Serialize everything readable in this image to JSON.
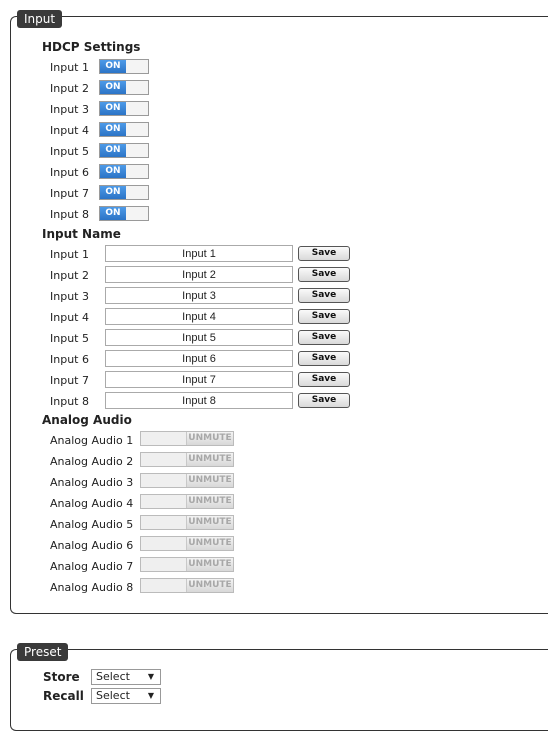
{
  "input_panel": {
    "legend": "Input"
  },
  "hdcp": {
    "title": "HDCP Settings",
    "on_label": "ON",
    "rows": [
      {
        "label": "Input 1"
      },
      {
        "label": "Input 2"
      },
      {
        "label": "Input 3"
      },
      {
        "label": "Input 4"
      },
      {
        "label": "Input 5"
      },
      {
        "label": "Input 6"
      },
      {
        "label": "Input 7"
      },
      {
        "label": "Input 8"
      }
    ]
  },
  "input_name": {
    "title": "Input Name",
    "save_label": "Save",
    "rows": [
      {
        "label": "Input 1",
        "value": "Input 1"
      },
      {
        "label": "Input 2",
        "value": "Input 2"
      },
      {
        "label": "Input 3",
        "value": "Input 3"
      },
      {
        "label": "Input 4",
        "value": "Input 4"
      },
      {
        "label": "Input 5",
        "value": "Input 5"
      },
      {
        "label": "Input 6",
        "value": "Input 6"
      },
      {
        "label": "Input 7",
        "value": "Input 7"
      },
      {
        "label": "Input 8",
        "value": "Input 8"
      }
    ]
  },
  "analog_audio": {
    "title": "Analog Audio",
    "unmute_label": "UNMUTE",
    "rows": [
      {
        "label": "Analog Audio 1"
      },
      {
        "label": "Analog Audio 2"
      },
      {
        "label": "Analog Audio 3"
      },
      {
        "label": "Analog Audio 4"
      },
      {
        "label": "Analog Audio 5"
      },
      {
        "label": "Analog Audio 6"
      },
      {
        "label": "Analog Audio 7"
      },
      {
        "label": "Analog Audio 8"
      }
    ]
  },
  "preset_panel": {
    "legend": "Preset",
    "store_label": "Store",
    "recall_label": "Recall",
    "store_value": "Select",
    "recall_value": "Select"
  },
  "colors": {
    "toggle_on": "#2b73c6",
    "legend_bg": "#3a3a3a"
  },
  "icons": {
    "dropdown": "chevron-down-icon"
  }
}
